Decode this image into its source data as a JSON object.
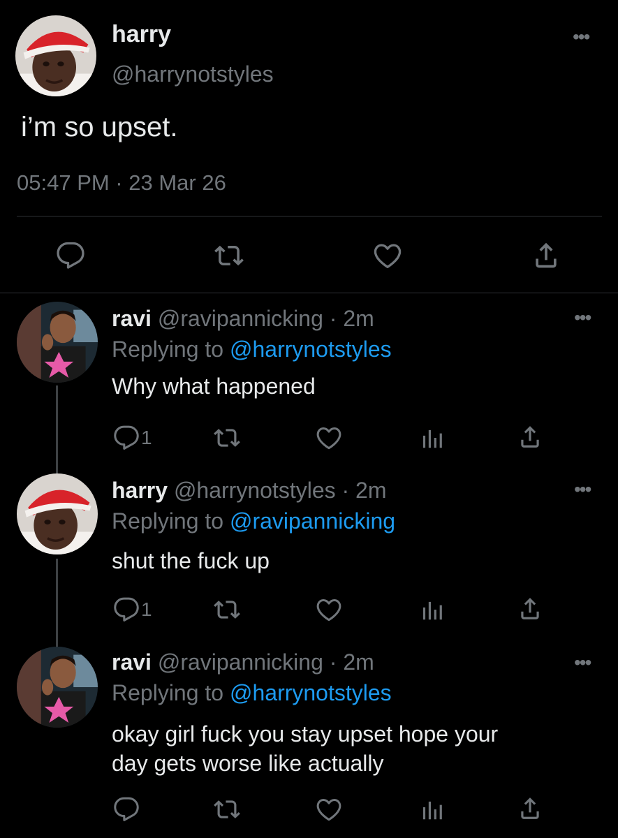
{
  "main_tweet": {
    "name": "harry",
    "handle": "@harrynotstyles",
    "text": "i’m so upset.",
    "timestamp": "05:47 PM · 23 Mar 26",
    "actions": [
      "comment-icon",
      "retweet-icon",
      "heart-icon",
      "share-icon"
    ]
  },
  "replies": [
    {
      "name": "ravi",
      "handle_time": "@ravipannicking · 2m",
      "replying_prefix": "Replying to",
      "replying_to": "@harrynotstyles",
      "text": "Why what happened",
      "reply_count": "1"
    },
    {
      "name": "harry",
      "handle_time": "@harrynotstyles · 2m",
      "replying_prefix": "Replying to",
      "replying_to": "@ravipannicking",
      "text": "shut the fuck up",
      "reply_count": "1"
    },
    {
      "name": "ravi",
      "handle_time": "@ravipannicking · 2m",
      "replying_prefix": "Replying to",
      "replying_to": "@harrynotstyles",
      "text_line1": "okay girl fuck you stay upset hope your",
      "text_line2": "day gets worse like actually",
      "reply_count": ""
    }
  ],
  "colors": {
    "background": "#000000",
    "text": "#e7e9ea",
    "secondary": "#71767b",
    "link": "#1d9bf0",
    "divider": "#2f3336"
  }
}
